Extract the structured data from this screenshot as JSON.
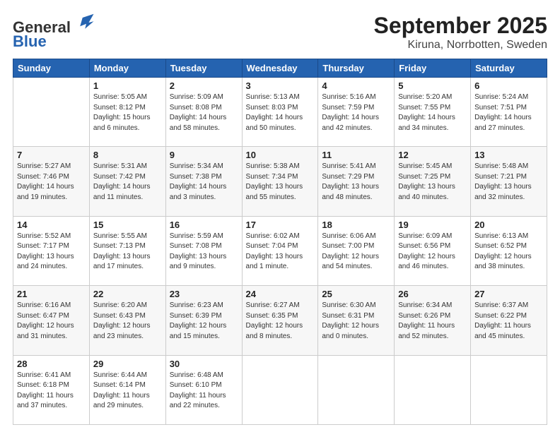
{
  "header": {
    "logo_line1": "General",
    "logo_line2": "Blue",
    "title": "September 2025",
    "location": "Kiruna, Norrbotten, Sweden"
  },
  "weekdays": [
    "Sunday",
    "Monday",
    "Tuesday",
    "Wednesday",
    "Thursday",
    "Friday",
    "Saturday"
  ],
  "weeks": [
    [
      {
        "day": "",
        "info": ""
      },
      {
        "day": "1",
        "info": "Sunrise: 5:05 AM\nSunset: 8:12 PM\nDaylight: 15 hours\nand 6 minutes."
      },
      {
        "day": "2",
        "info": "Sunrise: 5:09 AM\nSunset: 8:08 PM\nDaylight: 14 hours\nand 58 minutes."
      },
      {
        "day": "3",
        "info": "Sunrise: 5:13 AM\nSunset: 8:03 PM\nDaylight: 14 hours\nand 50 minutes."
      },
      {
        "day": "4",
        "info": "Sunrise: 5:16 AM\nSunset: 7:59 PM\nDaylight: 14 hours\nand 42 minutes."
      },
      {
        "day": "5",
        "info": "Sunrise: 5:20 AM\nSunset: 7:55 PM\nDaylight: 14 hours\nand 34 minutes."
      },
      {
        "day": "6",
        "info": "Sunrise: 5:24 AM\nSunset: 7:51 PM\nDaylight: 14 hours\nand 27 minutes."
      }
    ],
    [
      {
        "day": "7",
        "info": "Sunrise: 5:27 AM\nSunset: 7:46 PM\nDaylight: 14 hours\nand 19 minutes."
      },
      {
        "day": "8",
        "info": "Sunrise: 5:31 AM\nSunset: 7:42 PM\nDaylight: 14 hours\nand 11 minutes."
      },
      {
        "day": "9",
        "info": "Sunrise: 5:34 AM\nSunset: 7:38 PM\nDaylight: 14 hours\nand 3 minutes."
      },
      {
        "day": "10",
        "info": "Sunrise: 5:38 AM\nSunset: 7:34 PM\nDaylight: 13 hours\nand 55 minutes."
      },
      {
        "day": "11",
        "info": "Sunrise: 5:41 AM\nSunset: 7:29 PM\nDaylight: 13 hours\nand 48 minutes."
      },
      {
        "day": "12",
        "info": "Sunrise: 5:45 AM\nSunset: 7:25 PM\nDaylight: 13 hours\nand 40 minutes."
      },
      {
        "day": "13",
        "info": "Sunrise: 5:48 AM\nSunset: 7:21 PM\nDaylight: 13 hours\nand 32 minutes."
      }
    ],
    [
      {
        "day": "14",
        "info": "Sunrise: 5:52 AM\nSunset: 7:17 PM\nDaylight: 13 hours\nand 24 minutes."
      },
      {
        "day": "15",
        "info": "Sunrise: 5:55 AM\nSunset: 7:13 PM\nDaylight: 13 hours\nand 17 minutes."
      },
      {
        "day": "16",
        "info": "Sunrise: 5:59 AM\nSunset: 7:08 PM\nDaylight: 13 hours\nand 9 minutes."
      },
      {
        "day": "17",
        "info": "Sunrise: 6:02 AM\nSunset: 7:04 PM\nDaylight: 13 hours\nand 1 minute."
      },
      {
        "day": "18",
        "info": "Sunrise: 6:06 AM\nSunset: 7:00 PM\nDaylight: 12 hours\nand 54 minutes."
      },
      {
        "day": "19",
        "info": "Sunrise: 6:09 AM\nSunset: 6:56 PM\nDaylight: 12 hours\nand 46 minutes."
      },
      {
        "day": "20",
        "info": "Sunrise: 6:13 AM\nSunset: 6:52 PM\nDaylight: 12 hours\nand 38 minutes."
      }
    ],
    [
      {
        "day": "21",
        "info": "Sunrise: 6:16 AM\nSunset: 6:47 PM\nDaylight: 12 hours\nand 31 minutes."
      },
      {
        "day": "22",
        "info": "Sunrise: 6:20 AM\nSunset: 6:43 PM\nDaylight: 12 hours\nand 23 minutes."
      },
      {
        "day": "23",
        "info": "Sunrise: 6:23 AM\nSunset: 6:39 PM\nDaylight: 12 hours\nand 15 minutes."
      },
      {
        "day": "24",
        "info": "Sunrise: 6:27 AM\nSunset: 6:35 PM\nDaylight: 12 hours\nand 8 minutes."
      },
      {
        "day": "25",
        "info": "Sunrise: 6:30 AM\nSunset: 6:31 PM\nDaylight: 12 hours\nand 0 minutes."
      },
      {
        "day": "26",
        "info": "Sunrise: 6:34 AM\nSunset: 6:26 PM\nDaylight: 11 hours\nand 52 minutes."
      },
      {
        "day": "27",
        "info": "Sunrise: 6:37 AM\nSunset: 6:22 PM\nDaylight: 11 hours\nand 45 minutes."
      }
    ],
    [
      {
        "day": "28",
        "info": "Sunrise: 6:41 AM\nSunset: 6:18 PM\nDaylight: 11 hours\nand 37 minutes."
      },
      {
        "day": "29",
        "info": "Sunrise: 6:44 AM\nSunset: 6:14 PM\nDaylight: 11 hours\nand 29 minutes."
      },
      {
        "day": "30",
        "info": "Sunrise: 6:48 AM\nSunset: 6:10 PM\nDaylight: 11 hours\nand 22 minutes."
      },
      {
        "day": "",
        "info": ""
      },
      {
        "day": "",
        "info": ""
      },
      {
        "day": "",
        "info": ""
      },
      {
        "day": "",
        "info": ""
      }
    ]
  ]
}
